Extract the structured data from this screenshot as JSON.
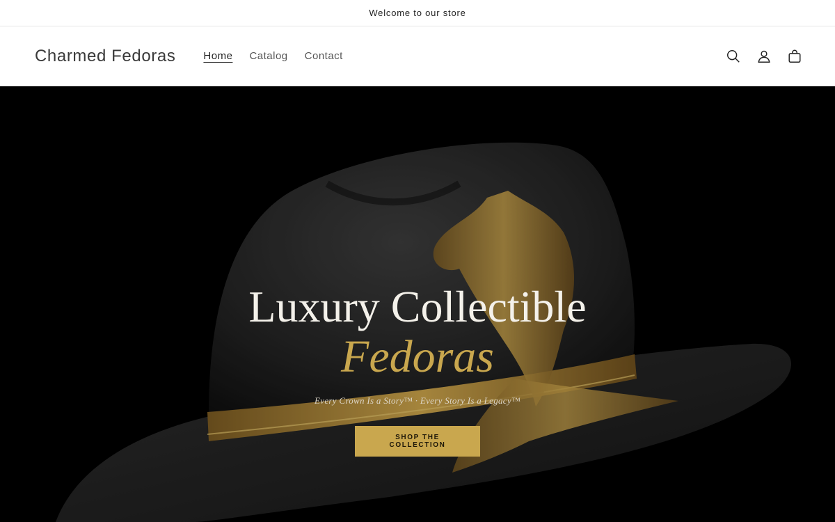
{
  "announcement": {
    "text": "Welcome to our store"
  },
  "header": {
    "logo": "Charmed Fedoras",
    "nav": [
      {
        "label": "Home"
      },
      {
        "label": "Catalog"
      },
      {
        "label": "Contact"
      }
    ],
    "icons": [
      "search-icon",
      "account-icon",
      "cart-icon"
    ]
  },
  "hero": {
    "title_line1": "Luxury Collectible",
    "title_line2": "Fedoras",
    "subtitle": "Every Crown Is a Story™ · Every Story Is a Legacy™",
    "cta_label": "SHOP THE COLLECTION",
    "colors": {
      "accent": "#c9a74e",
      "background": "#000000"
    }
  }
}
